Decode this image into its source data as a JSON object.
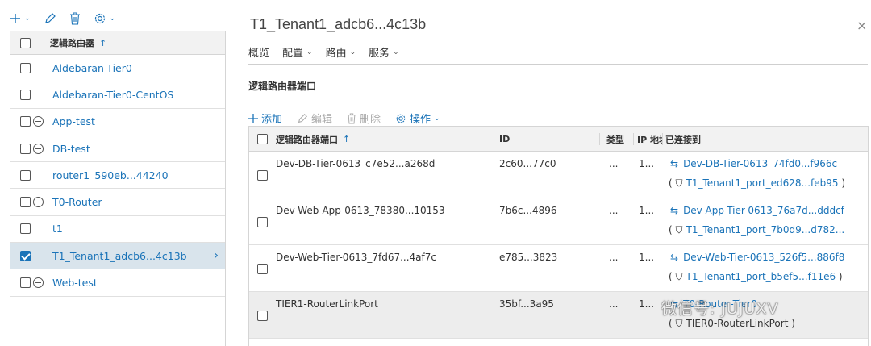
{
  "left_toolbar": {
    "add_icon": "plus-icon",
    "edit_icon": "pencil-icon",
    "delete_icon": "trash-icon",
    "actions_icon": "gear-icon"
  },
  "left_grid": {
    "header": "逻辑路由器",
    "sort_indicator": "↑",
    "rows": [
      {
        "label": "Aldebaran-Tier0",
        "group": false,
        "selected": false
      },
      {
        "label": "Aldebaran-Tier0-CentOS",
        "group": false,
        "selected": false
      },
      {
        "label": "App-test",
        "group": true,
        "selected": false
      },
      {
        "label": "DB-test",
        "group": true,
        "selected": false
      },
      {
        "label": "router1_590eb...44240",
        "group": false,
        "selected": false
      },
      {
        "label": "T0-Router",
        "group": true,
        "selected": false
      },
      {
        "label": "t1",
        "group": false,
        "selected": false
      },
      {
        "label": "T1_Tenant1_adcb6...4c13b",
        "group": false,
        "selected": true
      },
      {
        "label": "Web-test",
        "group": true,
        "selected": false
      }
    ]
  },
  "detail": {
    "title": "T1_Tenant1_adcb6...4c13b",
    "close": "×",
    "tabs": [
      {
        "label": "概览",
        "dropdown": false
      },
      {
        "label": "配置",
        "dropdown": true
      },
      {
        "label": "路由",
        "dropdown": true
      },
      {
        "label": "服务",
        "dropdown": true
      }
    ],
    "section_title": "逻辑路由器端口",
    "actions": {
      "add": "添加",
      "edit": "编辑",
      "delete": "删除",
      "ops": "操作"
    },
    "columns": {
      "port": "逻辑路由器端口",
      "sort": "↑",
      "id": "ID",
      "type": "类型",
      "ip": "IP 地址",
      "connected": "已连接到"
    },
    "rows": [
      {
        "port": "Dev-DB-Tier-0613_c7e52...a268d",
        "id": "2c60...77c0",
        "type": "...",
        "ip": "1...",
        "conn1": "Dev-DB-Tier-0613_74fd0...f966c",
        "conn2_prefix": "( ",
        "conn2": "T1_Tenant1_port_ed628...feb95",
        "conn2_suffix": " )"
      },
      {
        "port": "Dev-Web-App-0613_78380...10153",
        "id": "7b6c...4896",
        "type": "...",
        "ip": "1...",
        "conn1": "Dev-App-Tier-0613_76a7d...dddcf",
        "conn2_prefix": "( ",
        "conn2": "T1_Tenant1_port_7b0d9...d782...",
        "conn2_suffix": ""
      },
      {
        "port": "Dev-Web-Tier-0613_7fd67...4af7c",
        "id": "e785...3823",
        "type": "...",
        "ip": "1...",
        "conn1": "Dev-Web-Tier-0613_526f5...886f8",
        "conn2_prefix": "( ",
        "conn2": "T1_Tenant1_port_b5ef5...f11e6",
        "conn2_suffix": " )"
      },
      {
        "port": "TIER1-RouterLinkPort",
        "id": "35bf...3a95",
        "type": "...",
        "ip": "1...",
        "conn1": "T0-Router-Tier0",
        "conn2_prefix": "( ",
        "conn2": "TIER0-RouterLinkPort",
        "conn2_suffix": " )"
      }
    ]
  },
  "watermark": "微信号: JUJUXV",
  "colors": {
    "accent": "#1a73b8",
    "selected_row": "#d9e4ec",
    "header_bg": "#f2f2f2"
  }
}
